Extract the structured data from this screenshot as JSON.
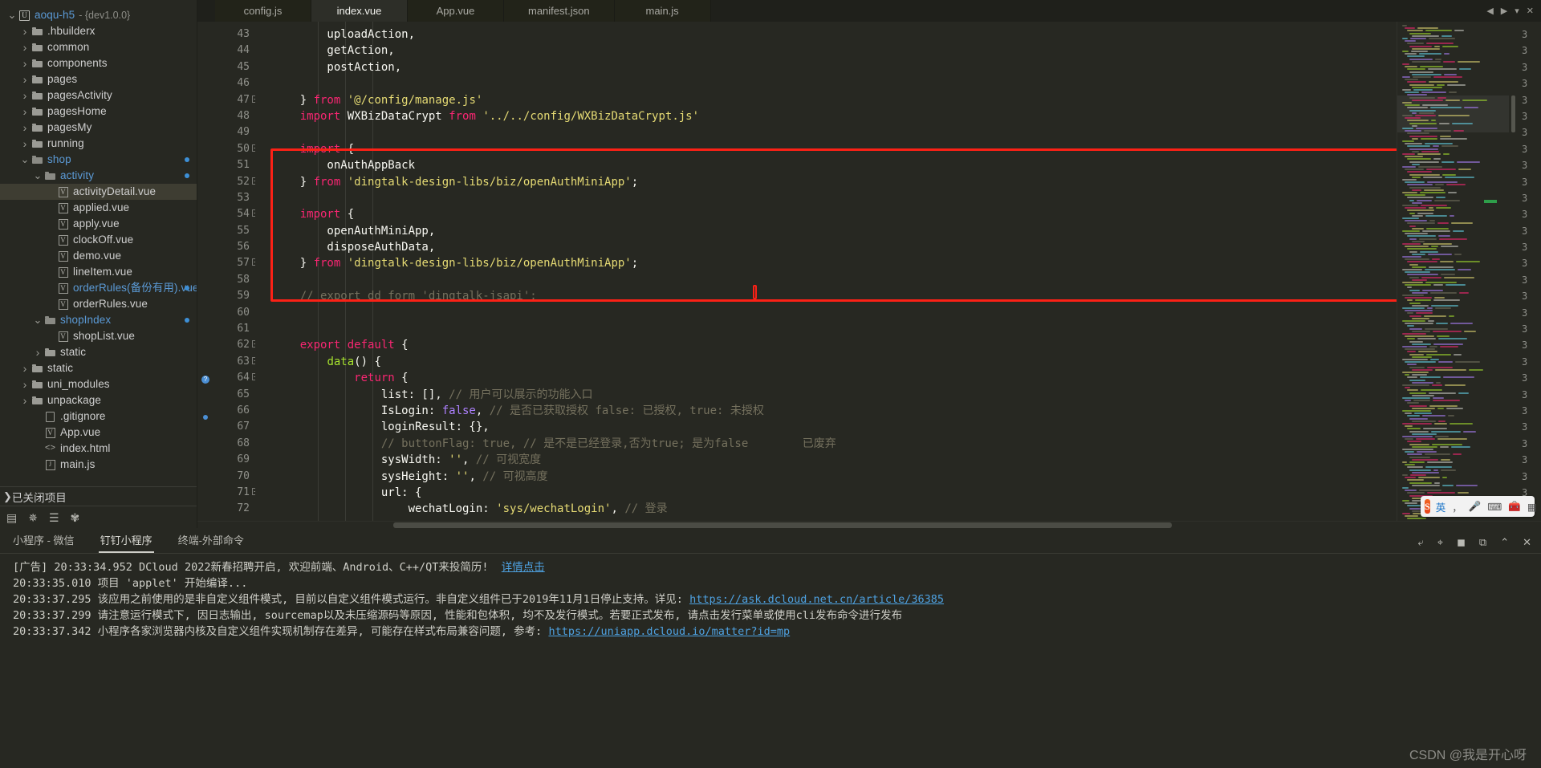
{
  "sidebar": {
    "tree": [
      {
        "depth": 0,
        "caret": "down",
        "icon": "project-icon",
        "label": "aoqu-h5",
        "color": "blue",
        "version": "- {dev1.0.0}"
      },
      {
        "depth": 1,
        "caret": "right",
        "icon": "folder-icon",
        "label": ".hbuilderx",
        "color": "white"
      },
      {
        "depth": 1,
        "caret": "right",
        "icon": "folder-icon",
        "label": "common",
        "color": "white"
      },
      {
        "depth": 1,
        "caret": "right",
        "icon": "folder-icon",
        "label": "components",
        "color": "white"
      },
      {
        "depth": 1,
        "caret": "right",
        "icon": "folder-icon",
        "label": "pages",
        "color": "white"
      },
      {
        "depth": 1,
        "caret": "right",
        "icon": "folder-icon",
        "label": "pagesActivity",
        "color": "white"
      },
      {
        "depth": 1,
        "caret": "right",
        "icon": "folder-icon",
        "label": "pagesHome",
        "color": "white"
      },
      {
        "depth": 1,
        "caret": "right",
        "icon": "folder-icon",
        "label": "pagesMy",
        "color": "white"
      },
      {
        "depth": 1,
        "caret": "right",
        "icon": "folder-icon",
        "label": "running",
        "color": "white"
      },
      {
        "depth": 1,
        "caret": "down",
        "icon": "folder-open-icon",
        "label": "shop",
        "color": "blue",
        "dot": true
      },
      {
        "depth": 2,
        "caret": "down",
        "icon": "folder-open-icon",
        "label": "activity",
        "color": "blue",
        "dot": true
      },
      {
        "depth": 3,
        "caret": "none",
        "icon": "vue-file-icon",
        "label": "activityDetail.vue",
        "color": "white",
        "selected": true
      },
      {
        "depth": 3,
        "caret": "none",
        "icon": "vue-file-icon",
        "label": "applied.vue",
        "color": "white"
      },
      {
        "depth": 3,
        "caret": "none",
        "icon": "vue-file-icon",
        "label": "apply.vue",
        "color": "white"
      },
      {
        "depth": 3,
        "caret": "none",
        "icon": "vue-file-icon",
        "label": "clockOff.vue",
        "color": "white"
      },
      {
        "depth": 3,
        "caret": "none",
        "icon": "vue-file-icon",
        "label": "demo.vue",
        "color": "white"
      },
      {
        "depth": 3,
        "caret": "none",
        "icon": "vue-file-icon",
        "label": "lineItem.vue",
        "color": "white"
      },
      {
        "depth": 3,
        "caret": "none",
        "icon": "vue-file-icon",
        "label": "orderRules(备份有用).vue",
        "color": "blue",
        "dot": true
      },
      {
        "depth": 3,
        "caret": "none",
        "icon": "vue-file-icon",
        "label": "orderRules.vue",
        "color": "white"
      },
      {
        "depth": 2,
        "caret": "down",
        "icon": "folder-open-icon",
        "label": "shopIndex",
        "color": "blue",
        "dot": true
      },
      {
        "depth": 3,
        "caret": "none",
        "icon": "vue-file-icon",
        "label": "shopList.vue",
        "color": "white"
      },
      {
        "depth": 2,
        "caret": "right",
        "icon": "folder-icon",
        "label": "static",
        "color": "white"
      },
      {
        "depth": 1,
        "caret": "right",
        "icon": "folder-icon",
        "label": "static",
        "color": "white"
      },
      {
        "depth": 1,
        "caret": "right",
        "icon": "folder-icon",
        "label": "uni_modules",
        "color": "white"
      },
      {
        "depth": 1,
        "caret": "right",
        "icon": "folder-icon",
        "label": "unpackage",
        "color": "white"
      },
      {
        "depth": 2,
        "caret": "none",
        "icon": "plain-file-icon",
        "label": ".gitignore",
        "color": "white"
      },
      {
        "depth": 2,
        "caret": "none",
        "icon": "vue-file-icon",
        "label": "App.vue",
        "color": "white"
      },
      {
        "depth": 2,
        "caret": "none",
        "icon": "html-file-icon",
        "label": "index.html",
        "color": "white"
      },
      {
        "depth": 2,
        "caret": "none",
        "icon": "js-file-icon",
        "label": "main.js",
        "color": "white"
      }
    ],
    "closed_projects": "已关闭项目",
    "toolbar": [
      {
        "name": "explorer-icon",
        "glyph": "▤"
      },
      {
        "name": "debug-icon",
        "glyph": "✵"
      },
      {
        "name": "search-icon",
        "glyph": "☰"
      },
      {
        "name": "plugin-icon",
        "glyph": "✾"
      }
    ]
  },
  "tabs": [
    {
      "label": "config.js",
      "active": false
    },
    {
      "label": "index.vue",
      "active": true
    },
    {
      "label": "App.vue",
      "active": false
    },
    {
      "label": "manifest.json",
      "active": false
    },
    {
      "label": "main.js",
      "active": false
    }
  ],
  "tab_nav": [
    {
      "name": "tab-prev-icon",
      "glyph": "◀"
    },
    {
      "name": "tab-next-icon",
      "glyph": "▶"
    },
    {
      "name": "tab-list-icon",
      "glyph": "▾"
    },
    {
      "name": "tab-close-icon",
      "glyph": "✕"
    }
  ],
  "editor": {
    "first_line": 43,
    "lines": [
      {
        "n": 43,
        "fold": "",
        "tokens": [
          {
            "t": "        uploadAction,",
            "c": "p"
          }
        ]
      },
      {
        "n": 44,
        "fold": "",
        "tokens": [
          {
            "t": "        getAction,",
            "c": "p"
          }
        ]
      },
      {
        "n": 45,
        "fold": "",
        "tokens": [
          {
            "t": "        postAction,",
            "c": "p"
          }
        ]
      },
      {
        "n": 46,
        "fold": "",
        "tokens": [
          {
            "t": "",
            "c": "p"
          }
        ]
      },
      {
        "n": 47,
        "fold": "-",
        "tokens": [
          {
            "t": "    } ",
            "c": "p"
          },
          {
            "t": "from",
            "c": "k"
          },
          {
            "t": " ",
            "c": "p"
          },
          {
            "t": "'@/config/manage.js'",
            "c": "s"
          }
        ]
      },
      {
        "n": 48,
        "fold": "",
        "tokens": [
          {
            "t": "    import",
            "c": "k"
          },
          {
            "t": " WXBizDataCrypt ",
            "c": "p"
          },
          {
            "t": "from",
            "c": "k"
          },
          {
            "t": " ",
            "c": "p"
          },
          {
            "t": "'../../config/WXBizDataCrypt.js'",
            "c": "s"
          }
        ]
      },
      {
        "n": 49,
        "fold": "",
        "tokens": [
          {
            "t": "",
            "c": "p"
          }
        ]
      },
      {
        "n": 50,
        "fold": "-",
        "tokens": [
          {
            "t": "    import",
            "c": "k"
          },
          {
            "t": " {",
            "c": "p"
          }
        ]
      },
      {
        "n": 51,
        "fold": "",
        "tokens": [
          {
            "t": "        onAuthAppBack",
            "c": "p"
          }
        ]
      },
      {
        "n": 52,
        "fold": "-",
        "tokens": [
          {
            "t": "    } ",
            "c": "p"
          },
          {
            "t": "from",
            "c": "k"
          },
          {
            "t": " ",
            "c": "p"
          },
          {
            "t": "'dingtalk-design-libs/biz/openAuthMiniApp'",
            "c": "s"
          },
          {
            "t": ";",
            "c": "p"
          }
        ]
      },
      {
        "n": 53,
        "fold": "",
        "tokens": [
          {
            "t": "",
            "c": "p"
          }
        ]
      },
      {
        "n": 54,
        "fold": "-",
        "tokens": [
          {
            "t": "    import",
            "c": "k"
          },
          {
            "t": " {",
            "c": "p"
          }
        ]
      },
      {
        "n": 55,
        "fold": "",
        "tokens": [
          {
            "t": "        openAuthMiniApp,",
            "c": "p"
          }
        ]
      },
      {
        "n": 56,
        "fold": "",
        "tokens": [
          {
            "t": "        disposeAuthData,",
            "c": "p"
          }
        ]
      },
      {
        "n": 57,
        "fold": "-",
        "tokens": [
          {
            "t": "    } ",
            "c": "p"
          },
          {
            "t": "from",
            "c": "k"
          },
          {
            "t": " ",
            "c": "p"
          },
          {
            "t": "'dingtalk-design-libs/biz/openAuthMiniApp'",
            "c": "s"
          },
          {
            "t": ";",
            "c": "p"
          }
        ]
      },
      {
        "n": 58,
        "fold": "",
        "tokens": [
          {
            "t": "",
            "c": "p"
          }
        ]
      },
      {
        "n": 59,
        "fold": "",
        "tokens": [
          {
            "t": "    // export dd form 'dingtalk-jsapi';",
            "c": "c"
          }
        ]
      },
      {
        "n": 60,
        "fold": "",
        "tokens": [
          {
            "t": "",
            "c": "p"
          }
        ]
      },
      {
        "n": 61,
        "fold": "",
        "tokens": [
          {
            "t": "",
            "c": "p"
          }
        ]
      },
      {
        "n": 62,
        "fold": "-",
        "tokens": [
          {
            "t": "    export default",
            "c": "k"
          },
          {
            "t": " {",
            "c": "p"
          }
        ]
      },
      {
        "n": 63,
        "fold": "-",
        "tokens": [
          {
            "t": "        ",
            "c": "p"
          },
          {
            "t": "data",
            "c": "fn"
          },
          {
            "t": "() {",
            "c": "p"
          }
        ]
      },
      {
        "n": 64,
        "fold": "-",
        "tokens": [
          {
            "t": "            ",
            "c": "p"
          },
          {
            "t": "return",
            "c": "k"
          },
          {
            "t": " {",
            "c": "p"
          }
        ]
      },
      {
        "n": 65,
        "fold": "",
        "tokens": [
          {
            "t": "                list: [], ",
            "c": "p"
          },
          {
            "t": "// 用户可以展示的功能入口",
            "c": "c"
          }
        ]
      },
      {
        "n": 66,
        "fold": "",
        "tokens": [
          {
            "t": "                IsLogin: ",
            "c": "p"
          },
          {
            "t": "false",
            "c": "n"
          },
          {
            "t": ", ",
            "c": "p"
          },
          {
            "t": "// 是否已获取授权 false: 已授权, true: 未授权",
            "c": "c"
          }
        ]
      },
      {
        "n": 67,
        "fold": "",
        "tokens": [
          {
            "t": "                loginResult: {},",
            "c": "p"
          }
        ]
      },
      {
        "n": 68,
        "fold": "",
        "tokens": [
          {
            "t": "                // buttonFlag: true, // 是不是已经登录,否为true; 是为false        已废弃",
            "c": "c"
          }
        ]
      },
      {
        "n": 69,
        "fold": "",
        "tokens": [
          {
            "t": "                sysWidth: ",
            "c": "p"
          },
          {
            "t": "''",
            "c": "s"
          },
          {
            "t": ", ",
            "c": "p"
          },
          {
            "t": "// 可视宽度",
            "c": "c"
          }
        ]
      },
      {
        "n": 70,
        "fold": "",
        "tokens": [
          {
            "t": "                sysHeight: ",
            "c": "p"
          },
          {
            "t": "''",
            "c": "s"
          },
          {
            "t": ", ",
            "c": "p"
          },
          {
            "t": "// 可视高度",
            "c": "c"
          }
        ]
      },
      {
        "n": 71,
        "fold": "-",
        "tokens": [
          {
            "t": "                url: {",
            "c": "p"
          }
        ]
      },
      {
        "n": 72,
        "fold": "",
        "tokens": [
          {
            "t": "                    wechatLogin: ",
            "c": "p"
          },
          {
            "t": "'sys/wechatLogin'",
            "c": "s"
          },
          {
            "t": ", ",
            "c": "p"
          },
          {
            "t": "// 登录",
            "c": "c"
          }
        ]
      }
    ],
    "right_numbers": [
      "3",
      "3",
      "3",
      "3",
      "3",
      "3",
      "3",
      "3",
      "3",
      "3",
      "3",
      "3",
      "3",
      "3",
      "3",
      "3",
      "3",
      "3",
      "3",
      "3",
      "3",
      "3",
      "3",
      "3",
      "3",
      "3",
      "3",
      "3",
      "3",
      "3"
    ],
    "annotation_color": "#fb2116"
  },
  "console": {
    "tabs": [
      {
        "label": "小程序 - 微信",
        "active": false
      },
      {
        "label": "钉钉小程序",
        "active": true
      },
      {
        "label": "终端-外部命令",
        "active": false
      }
    ],
    "tools": [
      {
        "name": "wrap-icon",
        "glyph": "⤶"
      },
      {
        "name": "filter-icon",
        "glyph": "⌖"
      },
      {
        "name": "stop-icon",
        "glyph": "◼"
      },
      {
        "name": "open-external-icon",
        "glyph": "⧉"
      },
      {
        "name": "collapse-icon",
        "glyph": "⌃"
      },
      {
        "name": "close-panel-icon",
        "glyph": "✕"
      }
    ],
    "lines": [
      [
        {
          "t": "[广告] 20:33:34.952 DCloud ",
          "c": "ad"
        },
        {
          "t": "2022新春招聘开启, 欢迎前端、Android、C++/QT来投简历!  ",
          "c": "ad"
        },
        {
          "t": "详情点击",
          "c": "lk"
        }
      ],
      [
        {
          "t": "20:33:35.010 项目 'applet' 开始编译...",
          "c": "ad"
        }
      ],
      [
        {
          "t": "20:33:37.295 该应用之前使用的是非自定义组件模式, 目前以自定义组件模式运行。非自定义组件已于2019年11月1日停止支持。详见: ",
          "c": "ad"
        },
        {
          "t": "https://ask.dcloud.net.cn/article/36385",
          "c": "lk"
        }
      ],
      [
        {
          "t": "20:33:37.299 请注意运行模式下, 因日志输出, sourcemap以及未压缩源码等原因, 性能和包体积, 均不及发行模式。若要正式发布, 请点击发行菜单或使用cli发布命令进行发布",
          "c": "ad"
        }
      ],
      [
        {
          "t": "20:33:37.342 小程序各家浏览器内核及自定义组件实现机制存在差异, 可能存在样式布局兼容问题, 参考: ",
          "c": "ad"
        },
        {
          "t": "https://uniapp.dcloud.io/matter?id=mp",
          "c": "lk"
        }
      ]
    ]
  },
  "ime": {
    "logo": "S",
    "items": [
      {
        "name": "ime-lang-toggle",
        "label": "英",
        "blue": true
      },
      {
        "name": "ime-punct-icon",
        "label": "，"
      },
      {
        "name": "ime-mic-icon",
        "label": "🎤"
      },
      {
        "name": "ime-keyboard-icon",
        "label": "⌨"
      },
      {
        "name": "ime-toolbox-icon",
        "label": "🧰"
      },
      {
        "name": "ime-menu-icon",
        "label": "▦"
      }
    ]
  },
  "watermark": "CSDN @我是开心呀"
}
